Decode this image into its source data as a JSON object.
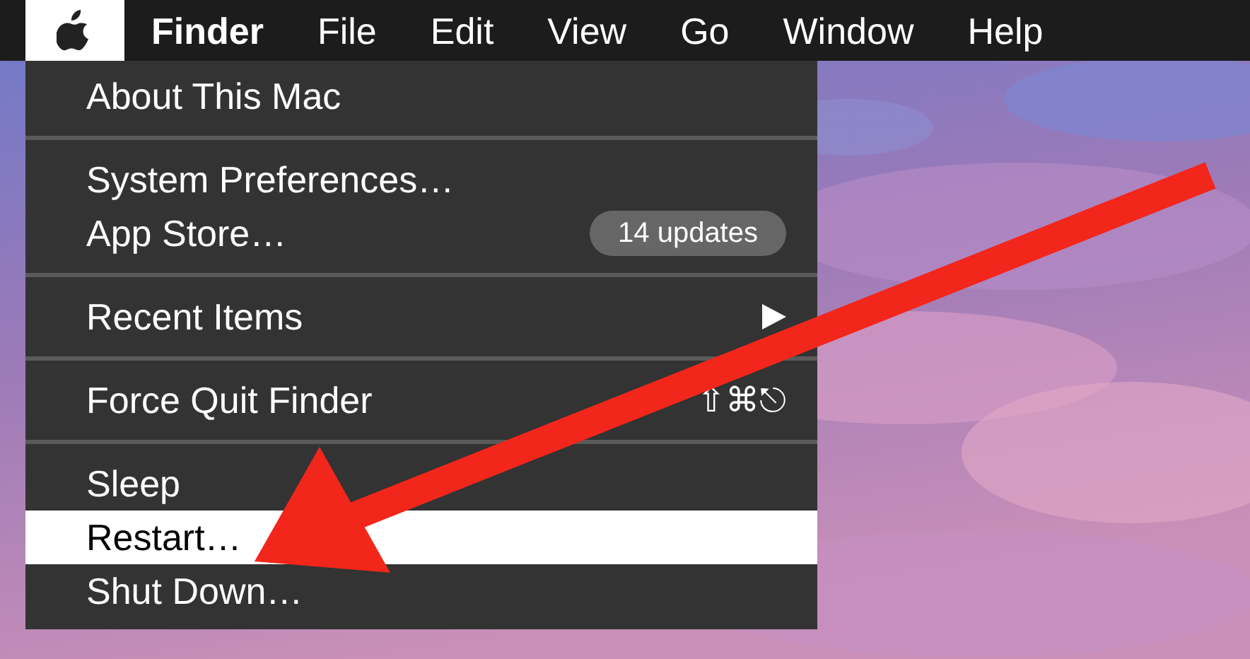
{
  "menu_bar": {
    "apple_menu": {
      "selected": true
    },
    "items": [
      {
        "label": "Finder",
        "kind": "app"
      },
      {
        "label": "File",
        "kind": "menu"
      },
      {
        "label": "Edit",
        "kind": "menu"
      },
      {
        "label": "View",
        "kind": "menu"
      },
      {
        "label": "Go",
        "kind": "menu"
      },
      {
        "label": "Window",
        "kind": "menu"
      },
      {
        "label": "Help",
        "kind": "menu"
      }
    ]
  },
  "apple_menu": {
    "groups": [
      [
        {
          "label": "About This Mac",
          "selected": false
        }
      ],
      [
        {
          "label": "System Preferences…",
          "selected": false
        },
        {
          "label": "App Store…",
          "selected": false,
          "badge": "14 updates"
        }
      ],
      [
        {
          "label": "Recent Items",
          "selected": false,
          "submenu": true
        }
      ],
      [
        {
          "label": "Force Quit Finder",
          "selected": false,
          "shortcut": "⇧⌘⎋"
        }
      ],
      [
        {
          "label": "Sleep",
          "selected": false
        },
        {
          "label": "Restart…",
          "selected": true
        },
        {
          "label": "Shut Down…",
          "selected": false
        }
      ]
    ]
  },
  "annotation": {
    "kind": "arrow"
  }
}
